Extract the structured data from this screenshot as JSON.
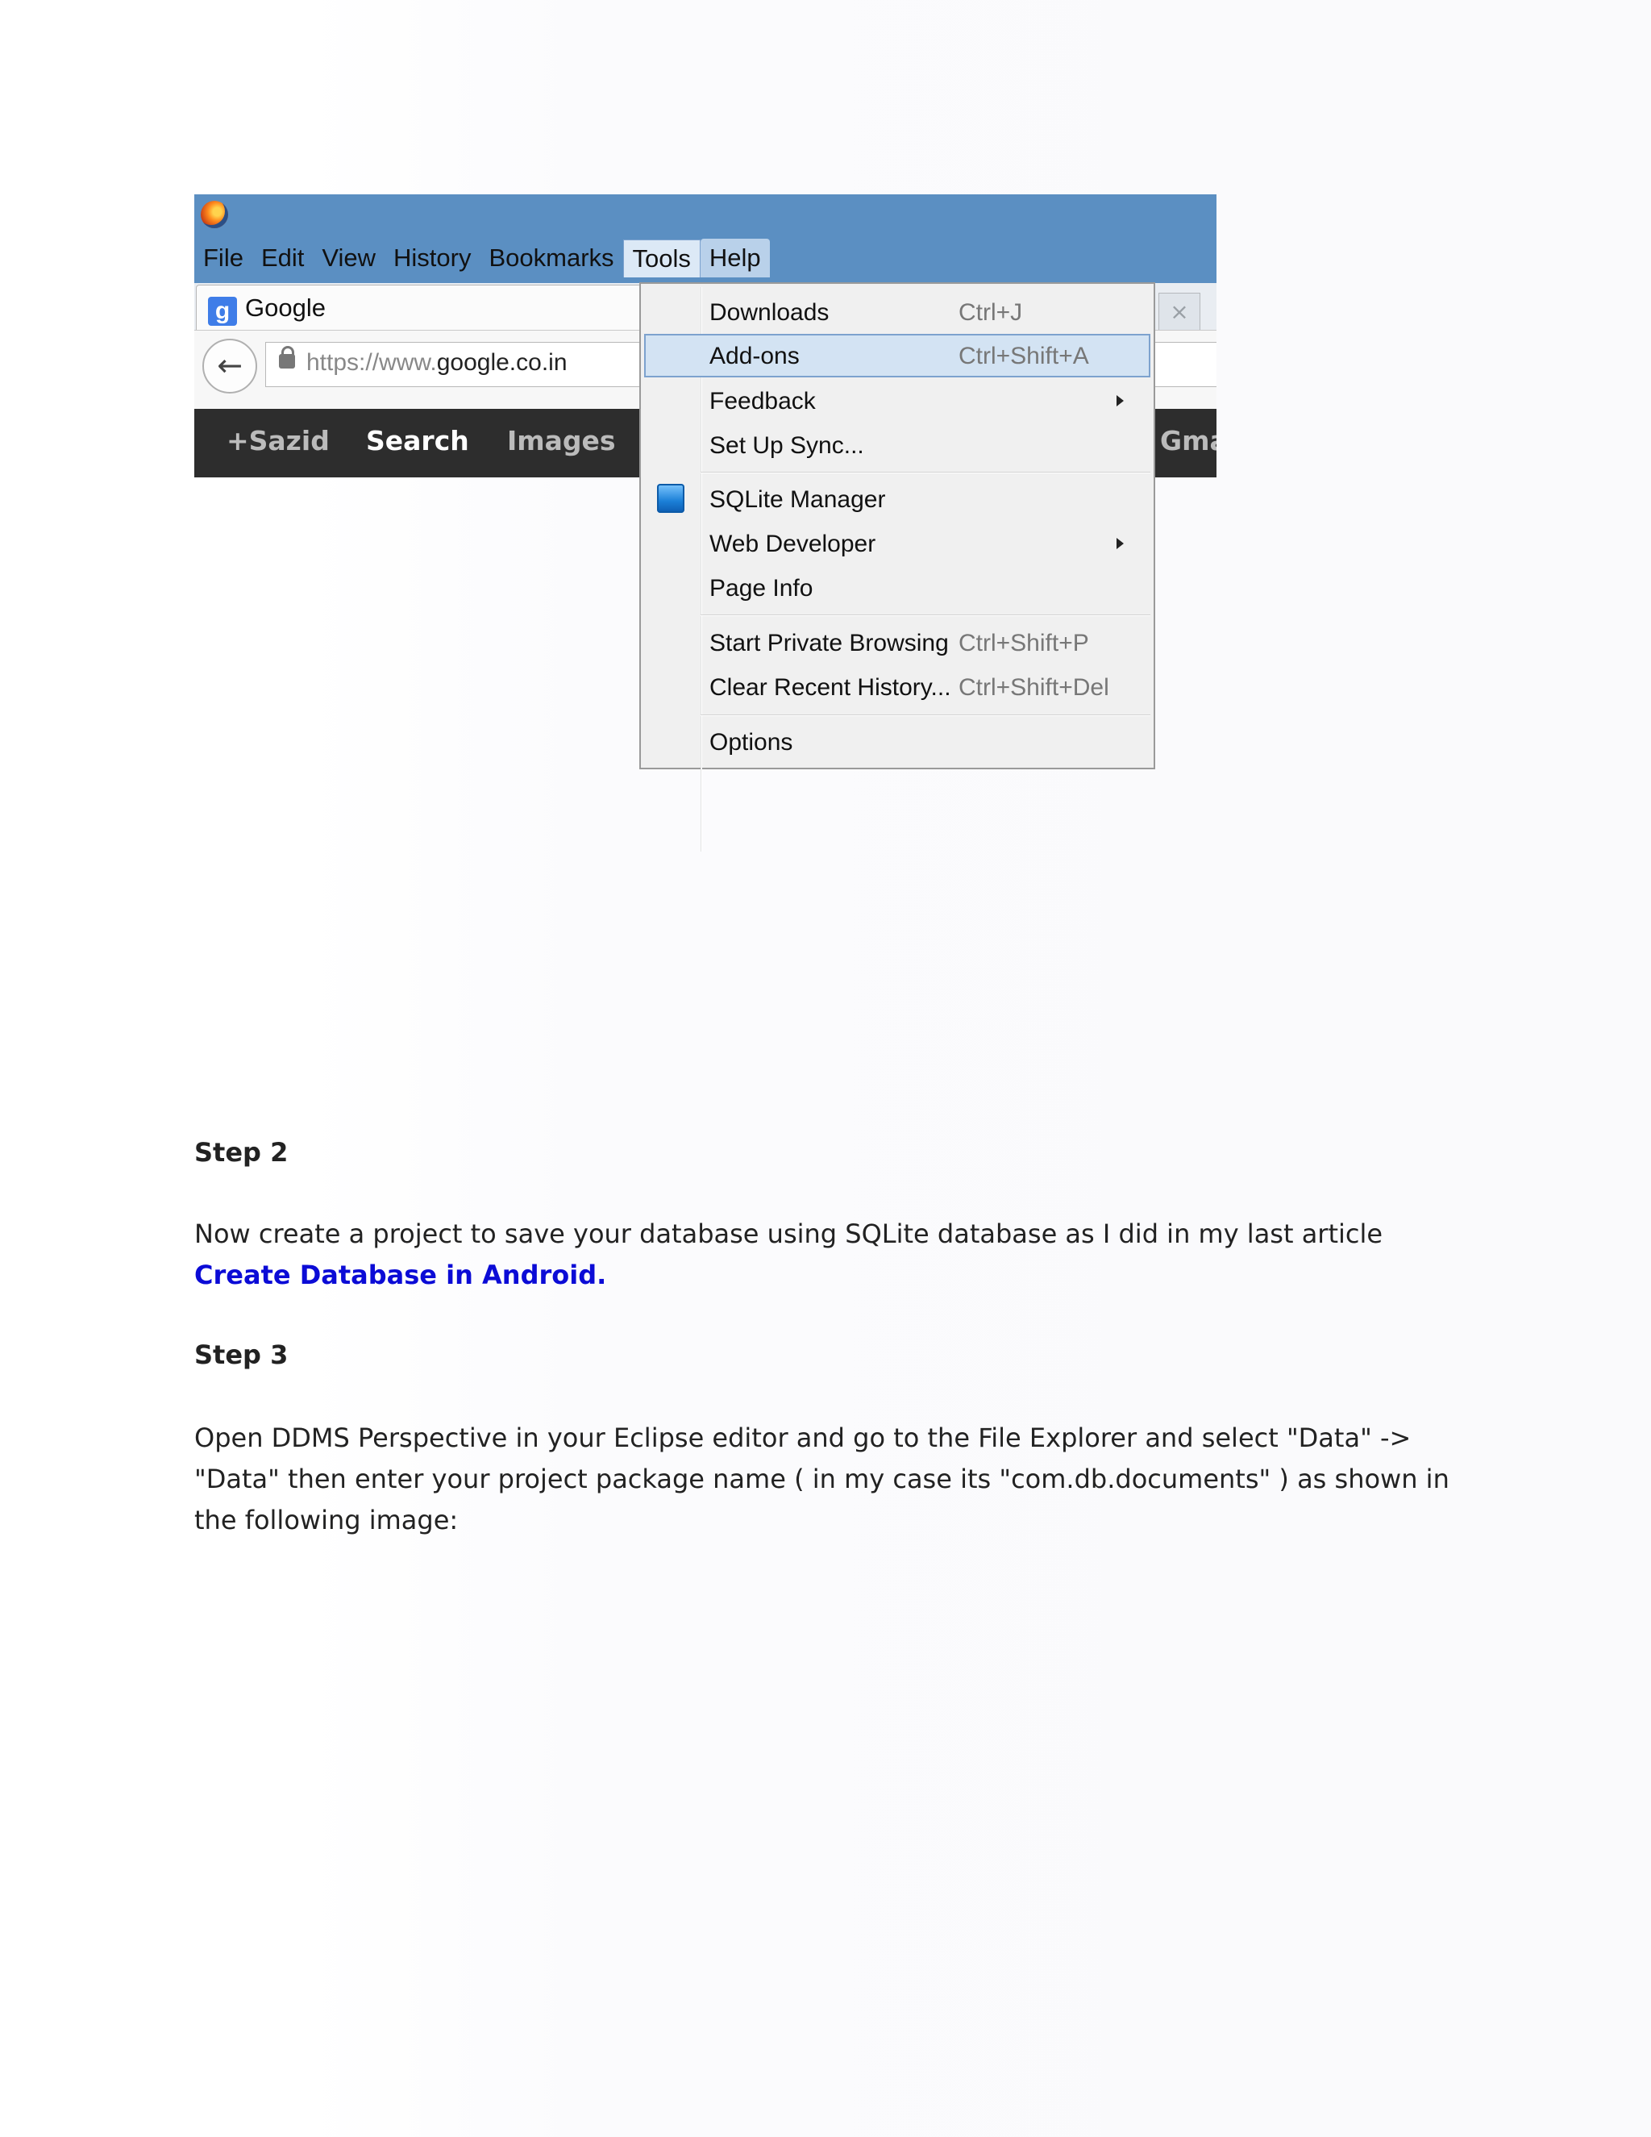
{
  "browser": {
    "menu": [
      "File",
      "Edit",
      "View",
      "History",
      "Bookmarks",
      "Tools",
      "Help"
    ],
    "tab_title": "Google",
    "google_icon_letter": "g",
    "close_glyph": "×",
    "back_glyph": "←",
    "url_prefix": "https://www.",
    "url_domain": "google.co.in",
    "google_bar": [
      "+Sazid",
      "Search",
      "Images",
      "Gma"
    ]
  },
  "tools_menu": {
    "items": [
      {
        "label": "Downloads",
        "shortcut": "Ctrl+J"
      },
      {
        "label": "Add-ons",
        "shortcut": "Ctrl+Shift+A",
        "highlighted": true
      },
      {
        "label": "Feedback",
        "submenu": true
      },
      {
        "label": "Set Up Sync..."
      },
      {
        "label": "SQLite Manager",
        "icon": "sqlite-icon"
      },
      {
        "label": "Web Developer",
        "submenu": true
      },
      {
        "label": "Page Info"
      },
      {
        "label": "Start Private Browsing",
        "shortcut": "Ctrl+Shift+P"
      },
      {
        "label": "Clear Recent History...",
        "shortcut": "Ctrl+Shift+Del"
      },
      {
        "label": "Options"
      }
    ]
  },
  "article": {
    "step2_heading": "Step 2",
    "step2_text": "Now create a project to save your database using SQLite database as I did in my last article ",
    "step2_link": "Create Database in Android.",
    "step3_heading": "Step 3",
    "step3_text": "Open DDMS Perspective in your Eclipse editor and go to the File Explorer and select \"Data\" -> \"Data\" then enter your project package name ( in my case its \"com.db.documents\" ) as shown in the following image:"
  },
  "colors": {
    "titlebar": "#5b8fc2",
    "link": "#0b0bd6",
    "menu_highlight": "#d3e3f3"
  }
}
